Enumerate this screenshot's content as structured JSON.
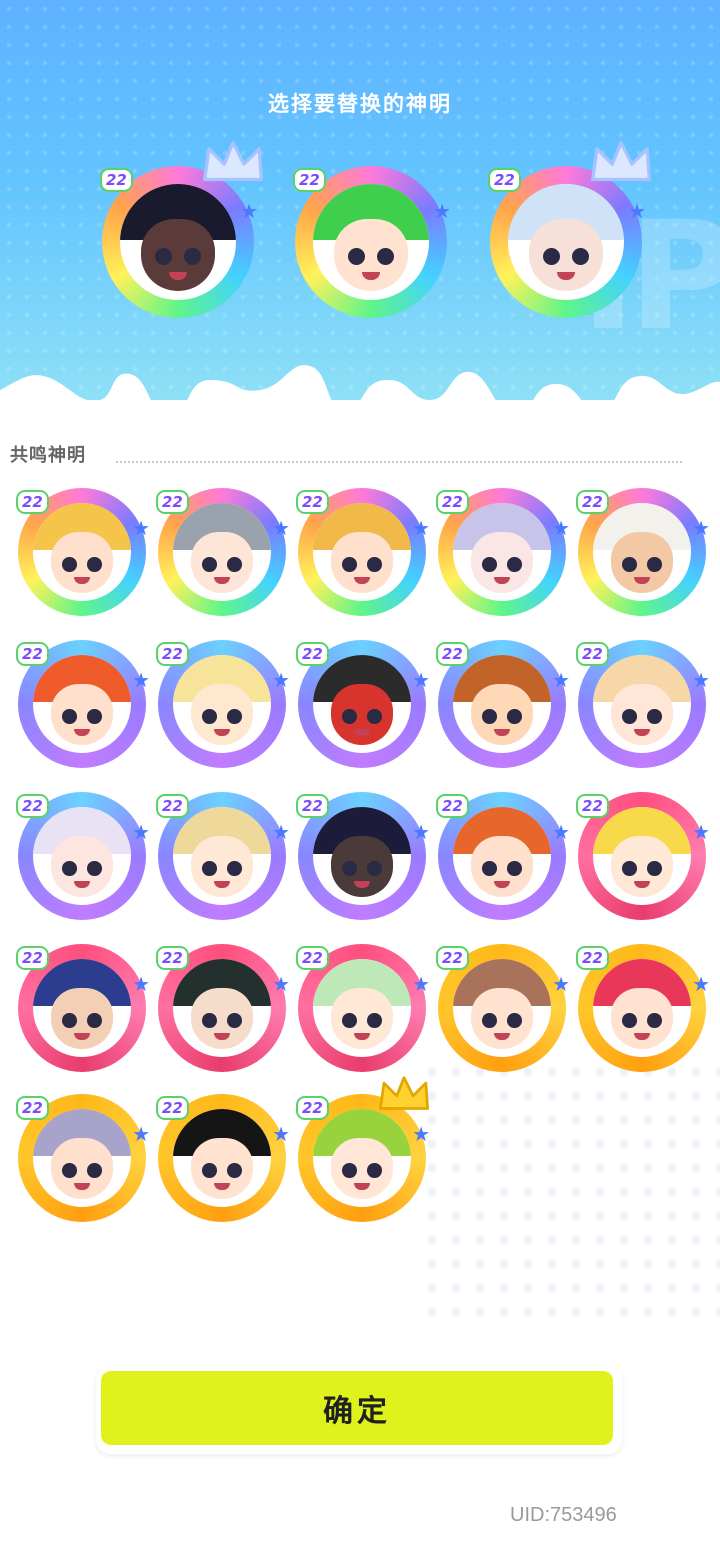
{
  "header": {
    "title": "选择要替换的神明"
  },
  "section": {
    "title": "共鸣神明"
  },
  "selected": [
    {
      "level": "22",
      "ring": "rainbow",
      "hair": "#1a1a2e",
      "skin": "#5b3b3a",
      "crown": true
    },
    {
      "level": "22",
      "ring": "rainbow",
      "hair": "#3fcf4d",
      "skin": "#ffe2cf",
      "crown": false
    },
    {
      "level": "22",
      "ring": "rainbow",
      "hair": "#cfe2f7",
      "skin": "#f6e0d8",
      "crown": true
    }
  ],
  "grid": [
    {
      "level": "22",
      "ring": "rainbow",
      "hair": "#f4c54a",
      "skin": "#ffe0cc"
    },
    {
      "level": "22",
      "ring": "rainbow",
      "hair": "#9aa3ad",
      "skin": "#fde6d8"
    },
    {
      "level": "22",
      "ring": "rainbow",
      "hair": "#f1b94a",
      "skin": "#ffe0cc"
    },
    {
      "level": "22",
      "ring": "rainbow",
      "hair": "#c8c3e8",
      "skin": "#fbe6e6"
    },
    {
      "level": "22",
      "ring": "rainbow",
      "hair": "#f3f1ec",
      "skin": "#f3c9a5"
    },
    {
      "level": "22",
      "ring": "purple",
      "hair": "#ef5b2a",
      "skin": "#ffe0cc"
    },
    {
      "level": "22",
      "ring": "purple",
      "hair": "#f7e39a",
      "skin": "#ffe8d0"
    },
    {
      "level": "22",
      "ring": "purple",
      "hair": "#2b2b2b",
      "skin": "#d8342e"
    },
    {
      "level": "22",
      "ring": "purple",
      "hair": "#c2632a",
      "skin": "#ffd8b8"
    },
    {
      "level": "22",
      "ring": "purple",
      "hair": "#f7d6a8",
      "skin": "#ffe6d6"
    },
    {
      "level": "22",
      "ring": "purple",
      "hair": "#e9e2f4",
      "skin": "#fde6e0"
    },
    {
      "level": "22",
      "ring": "purple",
      "hair": "#efd99a",
      "skin": "#ffe8d6"
    },
    {
      "level": "22",
      "ring": "purple",
      "hair": "#1c1c3a",
      "skin": "#4a3a3a"
    },
    {
      "level": "22",
      "ring": "purple",
      "hair": "#e6662c",
      "skin": "#ffe0cc"
    },
    {
      "level": "22",
      "ring": "pink",
      "hair": "#f7d94a",
      "skin": "#ffe8d6"
    },
    {
      "level": "22",
      "ring": "pink",
      "hair": "#2c3c8f",
      "skin": "#f2cfb5"
    },
    {
      "level": "22",
      "ring": "pink",
      "hair": "#23302d",
      "skin": "#f5dccb"
    },
    {
      "level": "22",
      "ring": "pink",
      "hair": "#bfe8b8",
      "skin": "#ffe8d6"
    },
    {
      "level": "22",
      "ring": "gold",
      "hair": "#a8735a",
      "skin": "#ffe2cf"
    },
    {
      "level": "22",
      "ring": "gold",
      "hair": "#e9375a",
      "skin": "#ffe2cf"
    },
    {
      "level": "22",
      "ring": "gold",
      "hair": "#a7a3c9",
      "skin": "#ffe0cc"
    },
    {
      "level": "22",
      "ring": "gold",
      "hair": "#151515",
      "skin": "#ffe2cf"
    },
    {
      "level": "22",
      "ring": "gold",
      "hair": "#98d23c",
      "skin": "#ffe6d6",
      "crown": true
    }
  ],
  "confirm_label": "确定",
  "uid": "UID:753496",
  "colors": {
    "accent_button": "#dff21c",
    "hero_blue": "#5fb2ff"
  }
}
